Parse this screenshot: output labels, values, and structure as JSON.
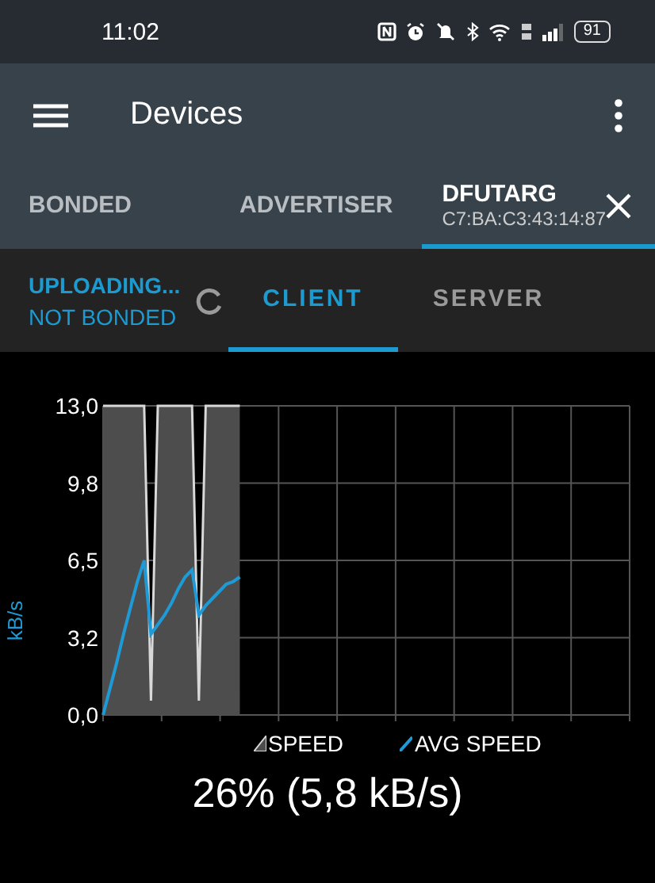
{
  "status_bar": {
    "time": "11:02",
    "battery": "91"
  },
  "app_bar": {
    "title": "Devices"
  },
  "tabs": [
    {
      "label": "BONDED",
      "selected": false
    },
    {
      "label": "ADVERTISER",
      "selected": false
    },
    {
      "label": "DFUTARG",
      "subtitle": "C7:BA:C3:43:14:87",
      "selected": true
    }
  ],
  "connection": {
    "state": "UPLOADING...",
    "bond": "NOT BONDED"
  },
  "sub_tabs": [
    {
      "label": "CLIENT",
      "selected": true
    },
    {
      "label": "SERVER",
      "selected": false
    }
  ],
  "chart_data": {
    "type": "line",
    "grid": true,
    "ylabel": "kB/s",
    "ylim": [
      0,
      13
    ],
    "yticks": [
      {
        "value": 0,
        "label": "0,0"
      },
      {
        "value": 3.25,
        "label": "3,2"
      },
      {
        "value": 6.5,
        "label": "6,5"
      },
      {
        "value": 9.75,
        "label": "9,8"
      },
      {
        "value": 13,
        "label": "13,0"
      }
    ],
    "categories": [
      null,
      null,
      null,
      null,
      null,
      null,
      null,
      null,
      null,
      null,
      null,
      null,
      null,
      null,
      null,
      null,
      null,
      null,
      null,
      null,
      null,
      null,
      null,
      null,
      null,
      null,
      null,
      null,
      null,
      null,
      null,
      null,
      null,
      null,
      null,
      null,
      null,
      null,
      null,
      null,
      null,
      null,
      null,
      null,
      null,
      null,
      null,
      null,
      null,
      null,
      null,
      null,
      null,
      null,
      null,
      null,
      null,
      null,
      null,
      null,
      null,
      null,
      null,
      null,
      null,
      null,
      null,
      null,
      null,
      null,
      null,
      null,
      null,
      null,
      null,
      null,
      null,
      null
    ],
    "series": [
      {
        "name": "SPEED",
        "color": "#d8d8d8",
        "values": [
          13,
          13,
          13,
          13,
          13,
          13,
          13,
          0.6,
          13,
          13,
          13,
          13,
          13,
          13,
          0.6,
          13,
          13,
          13,
          13,
          13,
          13,
          null,
          null,
          null,
          null,
          null,
          null,
          null,
          null,
          null,
          null,
          null,
          null,
          null,
          null,
          null,
          null,
          null,
          null,
          null,
          null,
          null,
          null,
          null,
          null,
          null,
          null,
          null,
          null,
          null,
          null,
          null,
          null,
          null,
          null,
          null,
          null,
          null,
          null,
          null,
          null,
          null,
          null,
          null,
          null,
          null,
          null,
          null,
          null,
          null,
          null,
          null,
          null,
          null,
          null,
          null,
          null,
          null
        ]
      },
      {
        "name": "AVG SPEED",
        "color": "#1e9bd7",
        "values": [
          0,
          1.1,
          2.2,
          3.4,
          4.5,
          5.6,
          6.5,
          3.4,
          3.8,
          4.2,
          4.7,
          5.3,
          5.8,
          6.1,
          4.2,
          4.6,
          4.9,
          5.2,
          5.5,
          5.6,
          5.8,
          null,
          null,
          null,
          null,
          null,
          null,
          null,
          null,
          null,
          null,
          null,
          null,
          null,
          null,
          null,
          null,
          null,
          null,
          null,
          null,
          null,
          null,
          null,
          null,
          null,
          null,
          null,
          null,
          null,
          null,
          null,
          null,
          null,
          null,
          null,
          null,
          null,
          null,
          null,
          null,
          null,
          null,
          null,
          null,
          null,
          null,
          null,
          null,
          null,
          null,
          null,
          null,
          null,
          null,
          null,
          null,
          null
        ]
      }
    ]
  },
  "progress": "26% (5,8 kB/s)"
}
